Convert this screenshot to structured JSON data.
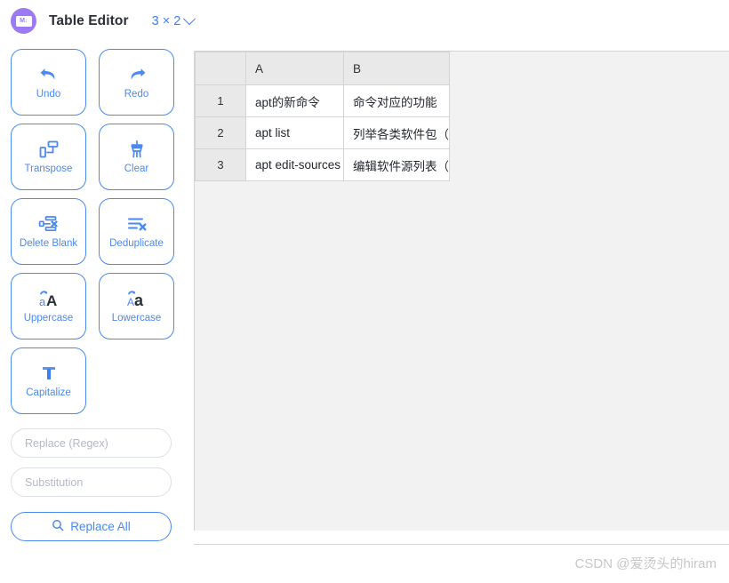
{
  "header": {
    "logo_icon": "markdown-logo-icon",
    "logo_text": "M↓",
    "title": "Table Editor",
    "dimensions_label": "3 × 2",
    "dropdown_icon": "chevron-down-icon"
  },
  "toolbar": {
    "buttons": [
      {
        "id": "undo",
        "label": "Undo",
        "icon": "undo-arrow-icon"
      },
      {
        "id": "redo",
        "label": "Redo",
        "icon": "redo-arrow-icon"
      },
      {
        "id": "transpose",
        "label": "Transpose",
        "icon": "transpose-icon"
      },
      {
        "id": "clear",
        "label": "Clear",
        "icon": "broom-icon"
      },
      {
        "id": "delete-blank",
        "label": "Delete Blank",
        "icon": "delete-blank-rows-icon"
      },
      {
        "id": "deduplicate",
        "label": "Deduplicate",
        "icon": "deduplicate-lines-icon"
      },
      {
        "id": "uppercase",
        "label": "Uppercase",
        "icon": "uppercase-aA-icon"
      },
      {
        "id": "lowercase",
        "label": "Lowercase",
        "icon": "lowercase-Aa-icon"
      },
      {
        "id": "capitalize",
        "label": "Capitalize",
        "icon": "capitalize-T-icon"
      }
    ],
    "replace_input": {
      "value": "",
      "placeholder": "Replace (Regex)"
    },
    "substitution_input": {
      "value": "",
      "placeholder": "Substitution"
    },
    "replace_all_button": {
      "label": "Replace All",
      "icon": "search-icon"
    }
  },
  "table": {
    "corner_label": "",
    "columns": [
      "A",
      "B"
    ],
    "rows": [
      {
        "number": "1",
        "cells": [
          "apt的新命令",
          "命令对应的功能"
        ]
      },
      {
        "number": "2",
        "cells": [
          "apt list",
          "列举各类软件包（"
        ]
      },
      {
        "number": "3",
        "cells": [
          "apt edit-sources",
          "编辑软件源列表（"
        ]
      }
    ]
  },
  "watermark": {
    "text": "CSDN @爱烫头的hiram"
  },
  "colors": {
    "accent_blue": "#4a88f2",
    "logo_purple": "#9b7af2",
    "panel_bg": "#f2f2f2",
    "header_cell_bg": "#e9e9e9",
    "border_gray": "#d4d4d4",
    "watermark_gray": "#c7c7c7"
  }
}
